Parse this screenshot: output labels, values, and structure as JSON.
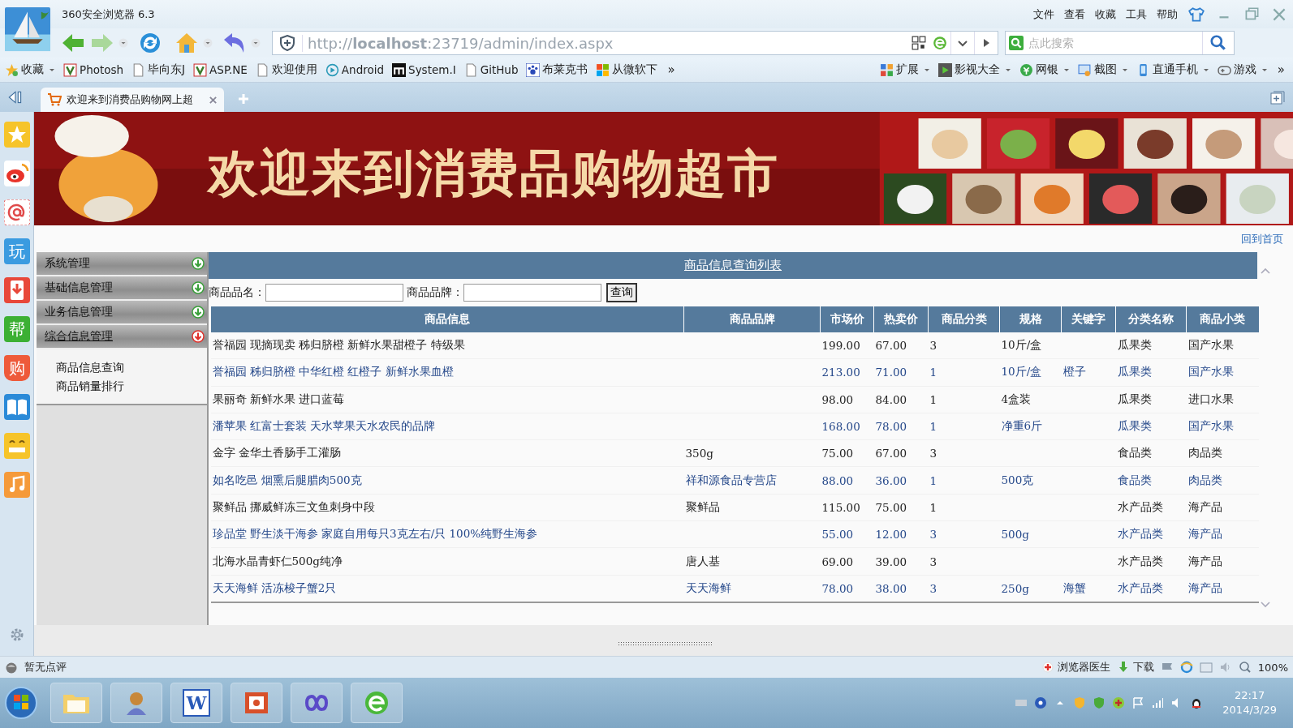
{
  "browser": {
    "title": "360安全浏览器 6.3",
    "menu": [
      "文件",
      "查看",
      "收藏",
      "工具",
      "帮助"
    ],
    "address": "http://**localhost**:23719/admin/index.aspx",
    "search_placeholder": "点此搜索",
    "bookmarks": [
      {
        "label": "收藏",
        "kind": "star"
      },
      {
        "label": "Photosh",
        "kind": "app"
      },
      {
        "label": "毕向东J",
        "kind": "page"
      },
      {
        "label": "ASP.NE",
        "kind": "app"
      },
      {
        "label": "欢迎使用",
        "kind": "page"
      },
      {
        "label": "Android",
        "kind": "play"
      },
      {
        "label": "System.I",
        "kind": "m"
      },
      {
        "label": "GitHub",
        "kind": "page"
      },
      {
        "label": "布莱克书",
        "kind": "paw"
      },
      {
        "label": "从微软下",
        "kind": "windows"
      }
    ],
    "bookmarks_more": "»",
    "tools": [
      {
        "label": "扩展",
        "kind": "grid"
      },
      {
        "label": "影视大全",
        "kind": "film"
      },
      {
        "label": "网银",
        "kind": "coin"
      },
      {
        "label": "截图",
        "kind": "shot"
      },
      {
        "label": "直通手机",
        "kind": "phone"
      },
      {
        "label": "游戏",
        "kind": "game"
      }
    ],
    "tools_more": "»",
    "tab": {
      "title": "欢迎来到消费品购物网上超",
      "selected": true
    }
  },
  "side_icons": [
    {
      "kind": "star"
    },
    {
      "kind": "weibo"
    },
    {
      "kind": "mail"
    },
    {
      "kind": "glyph",
      "label": "玩",
      "color": "#3a9be0"
    },
    {
      "kind": "download"
    },
    {
      "kind": "glyph",
      "label": "帮",
      "color": "#3cb034"
    },
    {
      "kind": "shop",
      "label": "购"
    },
    {
      "kind": "book"
    },
    {
      "kind": "face"
    },
    {
      "kind": "music"
    }
  ],
  "banner": {
    "title": "欢迎来到消费品购物超市"
  },
  "home_link": "回到首页",
  "menu": [
    {
      "label": "系统管理",
      "expanded": false
    },
    {
      "label": "基础信息管理",
      "expanded": false
    },
    {
      "label": "业务信息管理",
      "expanded": false
    },
    {
      "label": "综合信息管理",
      "expanded": true,
      "children": [
        {
          "label": "商品信息查询"
        },
        {
          "label": "商品销量排行"
        }
      ]
    }
  ],
  "panel": {
    "title": "商品信息查询列表",
    "filters": [
      {
        "label": "商品品名："
      },
      {
        "label": "商品品牌："
      }
    ],
    "button": "查询"
  },
  "table": {
    "columns": [
      "商品信息",
      "商品品牌",
      "市场价",
      "热卖价",
      "商品分类",
      "规格",
      "关键字",
      "分类名称",
      "商品小类"
    ],
    "rows": [
      {
        "kind": "plain",
        "info": "誉福园 现摘现卖 秭归脐橙 新鲜水果甜橙子 特级果",
        "market_price": "199.00",
        "sale_price": "67.00",
        "category": "3",
        "spec": "10斤/盒",
        "category_name": "瓜果类",
        "subcategory": "国产水果"
      },
      {
        "kind": "link",
        "info": "誉福园 秭归脐橙 中华红橙 红橙子 新鲜水果血橙",
        "market_price": "213.00",
        "sale_price": "71.00",
        "category": "1",
        "spec": "10斤/盒",
        "keyword": "橙子",
        "category_name": "瓜果类",
        "subcategory": "国产水果"
      },
      {
        "kind": "plain",
        "info": "果丽奇 新鲜水果 进口蓝莓",
        "market_price": "98.00",
        "sale_price": "84.00",
        "category": "1",
        "spec": "4盒装",
        "category_name": "瓜果类",
        "subcategory": "进口水果"
      },
      {
        "kind": "link",
        "info": "潘苹果 红富士套装 天水苹果天水农民的品牌",
        "market_price": "168.00",
        "sale_price": "78.00",
        "category": "1",
        "spec": "净重6斤",
        "category_name": "瓜果类",
        "subcategory": "国产水果"
      },
      {
        "kind": "plain",
        "info": "金字 金华土香肠手工灌肠",
        "brand": "350g",
        "market_price": "75.00",
        "sale_price": "67.00",
        "category": "3",
        "category_name": "食品类",
        "subcategory": "肉品类"
      },
      {
        "kind": "link",
        "info": "如名吃邑 烟熏后腿腊肉500克",
        "brand": "祥和源食品专营店",
        "market_price": "88.00",
        "sale_price": "36.00",
        "category": "1",
        "spec": "500克",
        "category_name": "食品类",
        "subcategory": "肉品类"
      },
      {
        "kind": "plain",
        "info": "聚鲜品 挪威鲜冻三文鱼刺身中段",
        "brand": "聚鲜品",
        "market_price": "115.00",
        "sale_price": "75.00",
        "category": "1",
        "category_name": "水产品类",
        "subcategory": "海产品"
      },
      {
        "kind": "link",
        "info": "珍品堂 野生淡干海参 家庭自用每只3克左右/只 100%纯野生海参",
        "market_price": "55.00",
        "sale_price": "12.00",
        "category": "3",
        "spec": "500g",
        "category_name": "水产品类",
        "subcategory": "海产品"
      },
      {
        "kind": "plain",
        "info": "北海水晶青虾仁500g纯净",
        "brand": "唐人基",
        "market_price": "69.00",
        "sale_price": "39.00",
        "category": "3",
        "category_name": "水产品类",
        "subcategory": "海产品"
      },
      {
        "kind": "link",
        "info": "天天海鲜 活冻梭子蟹2只",
        "brand": "天天海鲜",
        "market_price": "78.00",
        "sale_price": "38.00",
        "category": "3",
        "spec": "250g",
        "keyword": "海蟹",
        "category_name": "水产品类",
        "subcategory": "海产品"
      }
    ]
  },
  "status_bar": {
    "rating": "暂无点评",
    "doctor": "浏览器医生",
    "download": "下载",
    "zoom": "100%"
  },
  "taskbar": {
    "apps": [
      {
        "kind": "folder"
      },
      {
        "kind": "figure"
      },
      {
        "kind": "word",
        "label": "W"
      },
      {
        "kind": "slides"
      },
      {
        "kind": "infinity"
      },
      {
        "kind": "browser"
      }
    ],
    "time": "22:17",
    "date": "2014/3/29"
  }
}
